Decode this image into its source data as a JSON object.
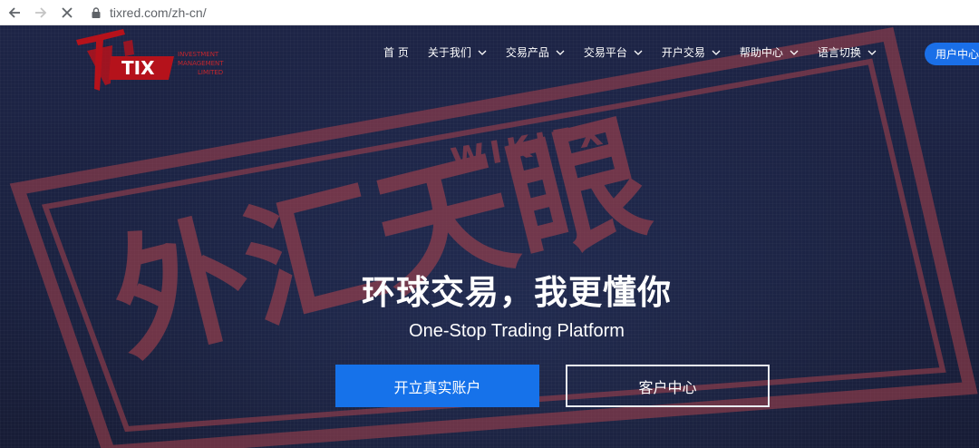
{
  "browser": {
    "url": "tixred.com/zh-cn/",
    "back_icon": "arrow-left-icon",
    "forward_icon": "arrow-right-icon",
    "stop_icon": "close-icon",
    "lock_icon": "lock-icon"
  },
  "logo": {
    "brand": "TIX",
    "tagline_lines": [
      "INVESTMENT",
      "MANAGEMENT",
      "LIMITED"
    ],
    "color": "#b5121b"
  },
  "nav": {
    "items": [
      {
        "label": "首 页",
        "has_dropdown": false
      },
      {
        "label": "关于我们",
        "has_dropdown": true
      },
      {
        "label": "交易产品",
        "has_dropdown": true
      },
      {
        "label": "交易平台",
        "has_dropdown": true
      },
      {
        "label": "开户交易",
        "has_dropdown": true
      },
      {
        "label": "帮助中心",
        "has_dropdown": true
      },
      {
        "label": "语言切换",
        "has_dropdown": true
      }
    ],
    "user_center_label": "用户中心"
  },
  "watermark": {
    "text": "外汇天眼",
    "color": "#b0464f"
  },
  "hero": {
    "headline": "环球交易，我更懂你",
    "subheadline": "One-Stop Trading Platform",
    "primary_cta": "开立真实账户",
    "secondary_cta": "客户中心"
  },
  "colors": {
    "accent": "#1672ea",
    "background": "#1b2340"
  }
}
